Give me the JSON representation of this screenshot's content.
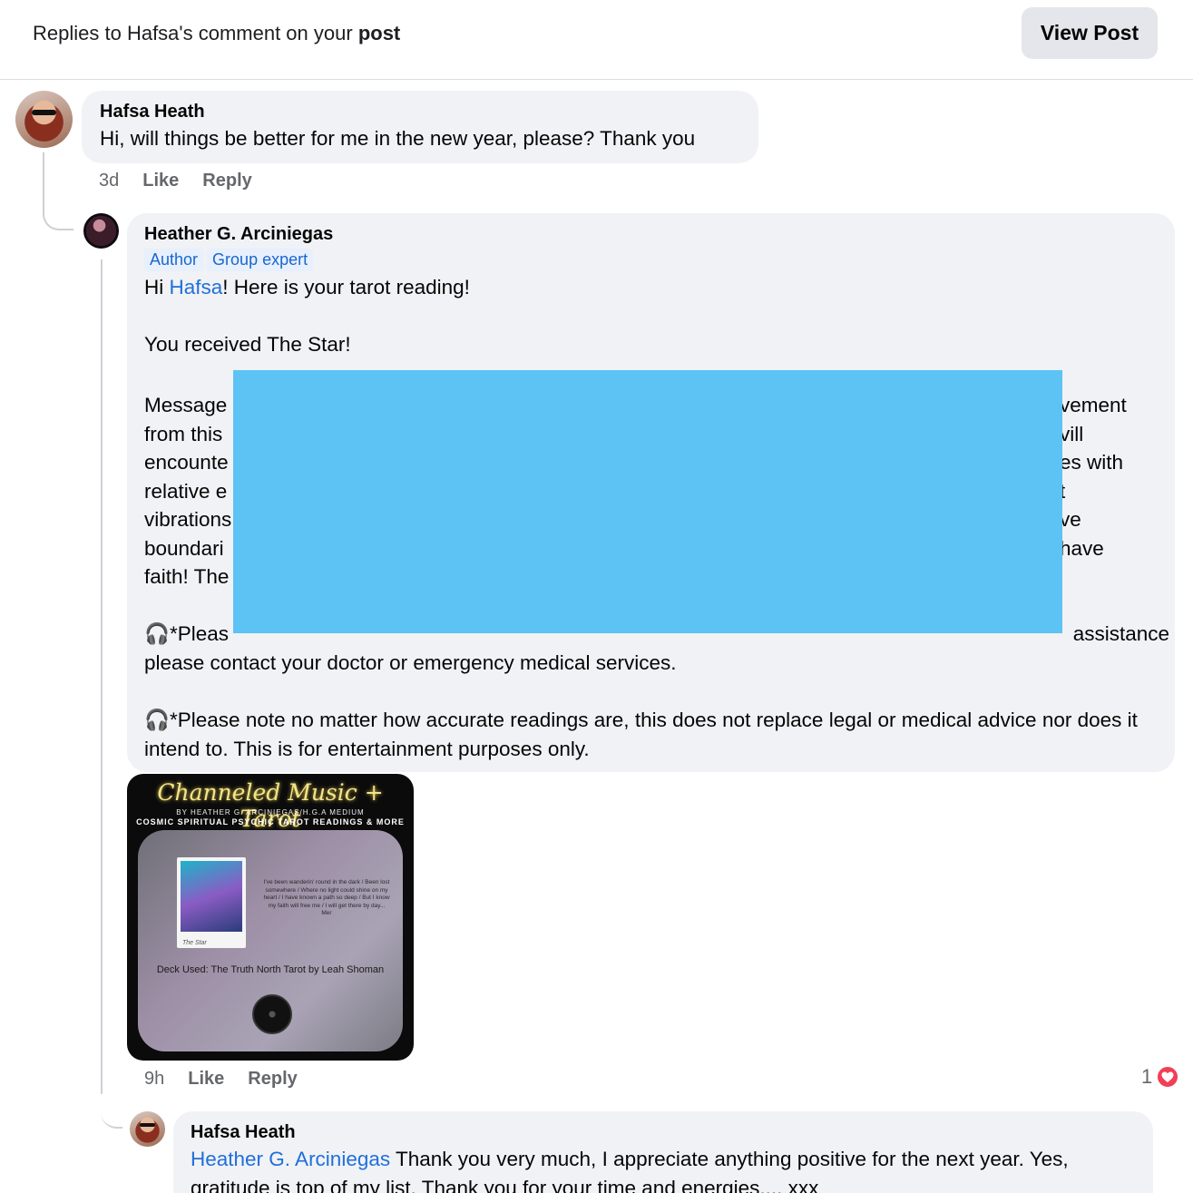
{
  "header": {
    "title_prefix": "Replies to Hafsa's comment on your ",
    "title_bold": "post",
    "view_post_label": "View Post"
  },
  "comment1": {
    "author": "Hafsa Heath",
    "text": "Hi, will things be better for me in the new year, please? Thank you",
    "time": "3d",
    "like": "Like",
    "reply": "Reply"
  },
  "reply1": {
    "author": "Heather G. Arciniegas",
    "badges": [
      "Author",
      "Group expert"
    ],
    "greeting_pre": "Hi ",
    "mention": "Hafsa",
    "greeting_post": "! Here is your tarot reading!",
    "received": "You received The Star!",
    "partial_left": [
      "Message",
      "from this",
      "encounte",
      "relative e",
      "vibrations",
      "boundari",
      "faith! The"
    ],
    "partial_right": [
      "vement",
      "vill",
      "es with",
      "t",
      "ve",
      "have",
      ""
    ],
    "note1_line1_left": "*Pleas",
    "note1_line1_right": "assistance",
    "note1_line2": "please contact your doctor or emergency medical services.",
    "note2": "*Please note no matter how accurate readings are, this does not replace legal or medical advice nor does it intend to. This is for entertainment purposes only.",
    "time": "9h",
    "like": "Like",
    "reply": "Reply",
    "reaction_count": "1"
  },
  "attachment": {
    "title": "Channeled Music + Tarot",
    "subtitle": "BY HEATHER G. ARCINIEGAS/H.G.A MEDIUM",
    "subtitle2": "COSMIC SPIRITUAL PSYCHIC TAROT READINGS & MORE",
    "card_caption": "The Star",
    "poem": "I've been wanderin' round in the dark / Been lost somewhere / Where no light could shine on my heart / I have known a path so deep / But I know my faith will free me / I will get there by day... Mer",
    "deck": "Deck Used: The Truth North Tarot by Leah Shoman"
  },
  "reply2": {
    "author": "Hafsa Heath",
    "mention": "Heather G. Arciniegas",
    "text": " Thank you very much, I appreciate anything positive for the next year. Yes, gratitude is top of my list. Thank you for your time and energies.... xxx"
  },
  "colors": {
    "accent": "#216fdb",
    "bubble": "#f0f2f5",
    "redaction": "#5cc3f4",
    "heart": "#f33e58"
  }
}
